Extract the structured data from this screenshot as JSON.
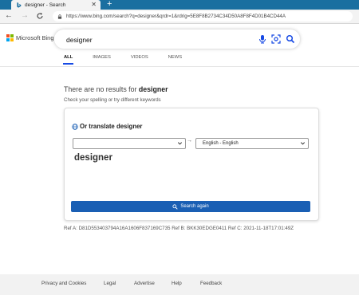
{
  "browser": {
    "tab_title": "designer - Search",
    "new_tab": "+",
    "close": "✕",
    "url": "https://www.bing.com/search?q=designer&qrdr=1&rdrig=5E8F8B2734C34D50A8F8F4D01B4CD44A"
  },
  "header": {
    "logo_text": "Microsoft Bing",
    "query": "designer"
  },
  "nav_tabs": [
    {
      "label": "ALL"
    },
    {
      "label": "IMAGES"
    },
    {
      "label": "VIDEOS"
    },
    {
      "label": "NEWS"
    }
  ],
  "results": {
    "no_results_prefix": "There are no results for ",
    "no_results_term": "designer",
    "hint": "Check your spelling or try different keywords"
  },
  "translate": {
    "title_prefix": "Or translate ",
    "title_term": "designer",
    "source_lang": "",
    "target_lang": "English - English",
    "arrow": "→",
    "word": "designer",
    "button_label": "Search again"
  },
  "refs": "Ref A: D81D553403794A16A1606F837169C735 Ref B: BKK30EDGE0411 Ref C: 2021-11-18T17:01:49Z",
  "footer": {
    "links": [
      "Privacy and Cookies",
      "Legal",
      "Advertise",
      "Help",
      "Feedback"
    ]
  },
  "colors": {
    "accent": "#174ae4",
    "button": "#1a5fb4",
    "tabbar": "#1a6fa0"
  }
}
